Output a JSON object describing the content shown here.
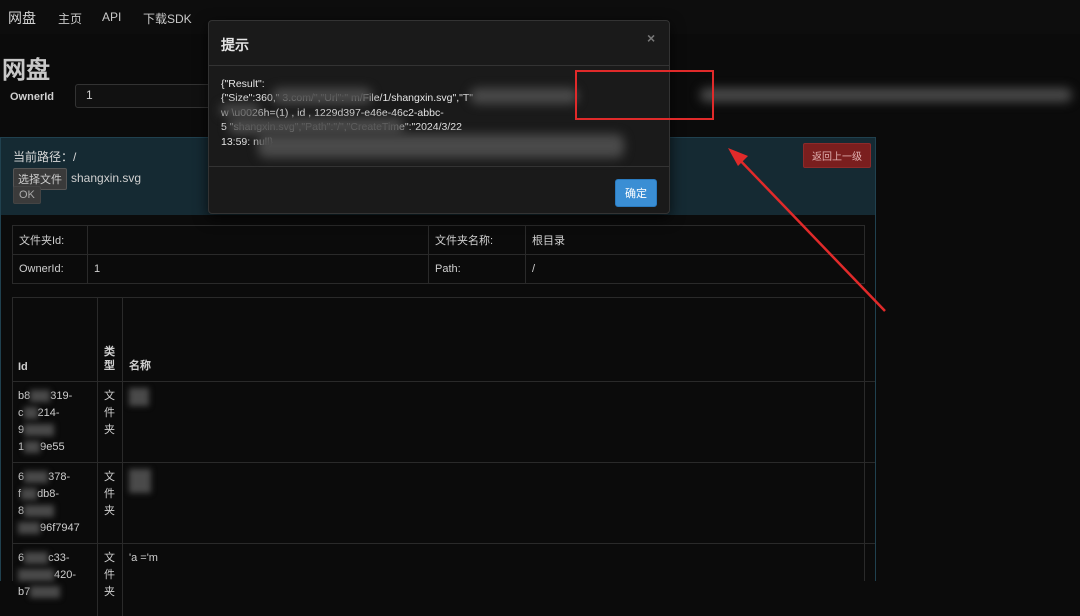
{
  "nav": {
    "brand": "网盘",
    "links": [
      "主页",
      "API",
      "下载SDK"
    ]
  },
  "page_title": "网盘",
  "owner": {
    "label": "OwnerId",
    "value": "1"
  },
  "panel": {
    "current_path_label": "当前路径：/",
    "choose_file_label": "选择文件",
    "file_name": "shangxin.svg",
    "ok_label": "OK",
    "back_label": "返回上一级"
  },
  "info": {
    "folder_id_label": "文件夹Id:",
    "folder_id_value": "",
    "folder_name_label": "文件夹名称:",
    "folder_name_value": "根目录",
    "owner_label": "OwnerId:",
    "owner_value": "1",
    "path_label": "Path:",
    "path_value": "/"
  },
  "list": {
    "headers": [
      "Id",
      "类型",
      "名称"
    ],
    "rows": [
      {
        "id": [
          "b8",
          "319-",
          "c",
          "214-",
          "9",
          "1",
          "9e55"
        ],
        "type": "文件夹",
        "name": ""
      },
      {
        "id": [
          "6",
          "378-",
          "f",
          "db8-",
          "8",
          "",
          "96f7947"
        ],
        "type": "文件夹",
        "name": ""
      },
      {
        "id": [
          "6",
          "c33-",
          "",
          "420-",
          "b7"
        ],
        "type": "文件夹",
        "name": "'a  ='m"
      }
    ]
  },
  "modal": {
    "title": "提示",
    "close": "×",
    "body_lines": [
      "{\"Result\":",
      "{\"Size\":360,\"                            3.com/\",\"Url\":\"                            m/File/1/shangxin.svg\",\"T\"",
      "w  \\u0026h=(1)   , id  , 1229d397-e46e-46c2-abbc-",
      "5                                      \"shangxin.svg\",\"Path\":\"/\",\"CreateTime\":\"2024/3/22",
      "13:59:                                                                        null}"
    ],
    "confirm": "确定"
  }
}
